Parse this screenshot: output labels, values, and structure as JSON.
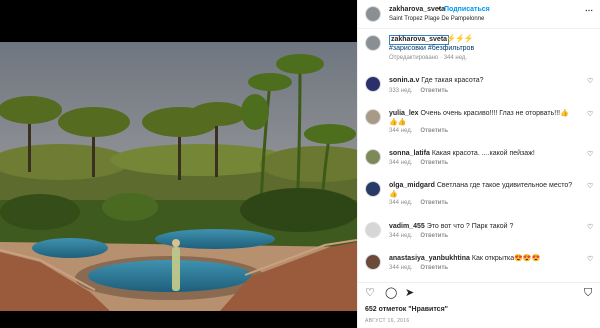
{
  "post": {
    "username": "zakharova_sveta",
    "follow_label": "Подписаться",
    "location": "Saint Tropez Plage De Pampelonne",
    "caption_emoji": "⚡⚡⚡",
    "caption_tags": "#зарисовки #безфильтров",
    "edited_note": "Отредактировано · 344 нед."
  },
  "comments": [
    {
      "user": "sonin.a.v",
      "text": "Где такая красота?",
      "time": "333 нед.",
      "reply": "Ответить"
    },
    {
      "user": "yulia_lex",
      "text": "Очень очень красиво!!!! Глаз не оторвать!!!👍👍👍",
      "time": "344 нед.",
      "reply": "Ответить"
    },
    {
      "user": "sonna_latifa",
      "text": "Какая красота. ....какой пейзаж!",
      "time": "344 нед.",
      "reply": "Ответить"
    },
    {
      "user": "olga_midgard",
      "text": "Светлана где такое удивительное место?👍",
      "time": "344 нед.",
      "reply": "Ответить"
    },
    {
      "user": "vadim_455",
      "text": "Это вот что ? Парк такой ?",
      "time": "344 нед.",
      "reply": "Ответить"
    },
    {
      "user": "anastasiya_yanbukhtina",
      "text": "Как открытка😍😍😍",
      "time": "344 нед.",
      "reply": "Ответить"
    }
  ],
  "footer": {
    "likes": "652 отметок \"Нравится\"",
    "date": "АВГУСТ 16, 2016"
  },
  "icons": {
    "more": "⋯",
    "heart": "♡",
    "comment": "◯",
    "share": "➤",
    "bookmark": "⛉"
  },
  "colors": {
    "follow": "#0095f6",
    "hashtag": "#00376b",
    "meta": "#8e8e8e"
  }
}
